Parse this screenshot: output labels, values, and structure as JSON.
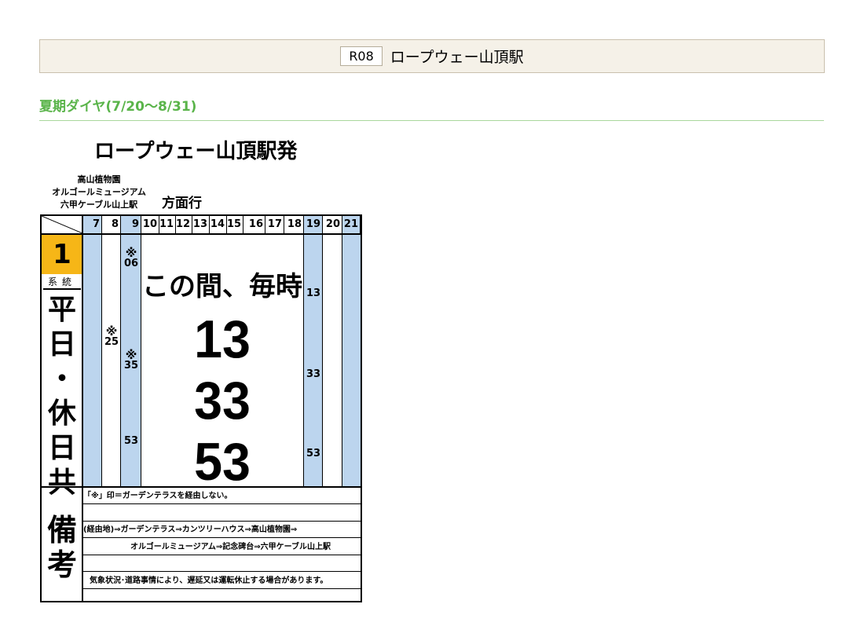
{
  "station": {
    "code": "R08",
    "name": "ロープウェー山頂駅"
  },
  "season": "夏期ダイヤ(7/20～8/31)",
  "timetable": {
    "title": "ロープウェー山頂駅発",
    "via": [
      "高山植物園",
      "オルゴールミュージアム",
      "六甲ケーブル山上駅"
    ],
    "direction_suffix": "方面行",
    "hours": [
      "7",
      "8",
      "9",
      "10",
      "11",
      "12",
      "13",
      "14",
      "15",
      "16",
      "17",
      "18",
      "19",
      "20",
      "21"
    ],
    "route_number": "1",
    "route_label": "系統",
    "day_type": "平日・休日共",
    "mark_symbol": "※",
    "every_hour_text": "この間、毎時",
    "hourly_minutes": [
      "13",
      "33",
      "53"
    ],
    "departures": {
      "8": [
        {
          "minute": "25",
          "mark": "※"
        }
      ],
      "9": [
        {
          "minute": "06",
          "mark": "※"
        },
        {
          "minute": "35",
          "mark": "※"
        },
        {
          "minute": "53",
          "mark": ""
        }
      ],
      "19": [
        {
          "minute": "13",
          "mark": ""
        },
        {
          "minute": "33",
          "mark": ""
        },
        {
          "minute": "53",
          "mark": ""
        }
      ]
    },
    "remarks_title": "備考",
    "remarks": [
      "「※」印＝ガーデンテラスを経由しない。",
      "",
      "(経由地)⇒ガーデンテラス⇒カンツリーハウス⇒高山植物園⇒",
      "オルゴールミュージアム⇒記念碑台⇒六甲ケーブル山上駅",
      "",
      "気象状況･道路事情により、遅延又は運転休止する場合があります。",
      ""
    ]
  },
  "colors": {
    "season": "#5ab44a",
    "highlight_column": "#bcd5ee",
    "route_badge": "#f6b617"
  }
}
